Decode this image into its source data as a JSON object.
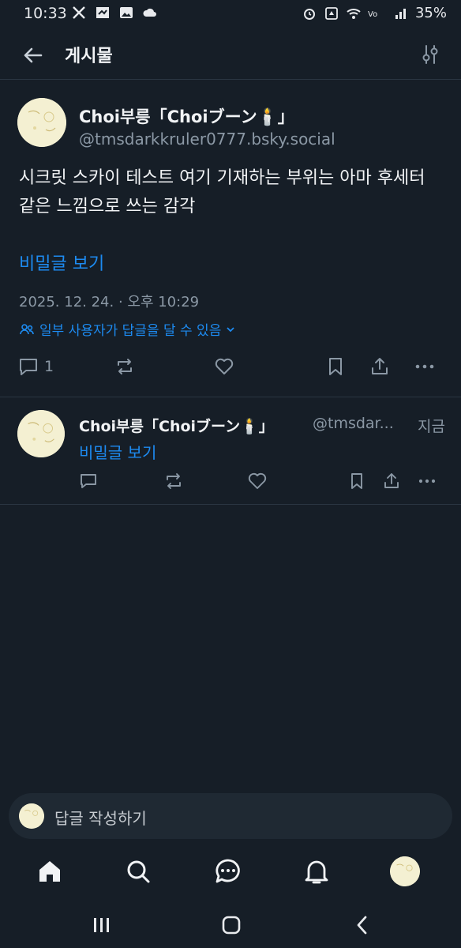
{
  "status_bar": {
    "time": "10:33",
    "battery": "35%",
    "left_icons": [
      "x-icon",
      "bird-icon",
      "image-icon",
      "cloud-icon"
    ],
    "right_icons": [
      "alarm-icon",
      "recycle-icon",
      "wifi-icon",
      "volte-icon",
      "signal-icon"
    ]
  },
  "header": {
    "title": "게시물"
  },
  "post": {
    "author_name": "Choi부릉「Choiブーン🕯️」",
    "author_handle": "@tmsdarkkruler0777.bsky.social",
    "text": "시크릿 스카이 테스트 여기 기재하는 부위는 아마 후세터 같은 느낌으로 쓰는 감각",
    "link_text": "비밀글 보기",
    "date": "2025. 12. 24. · 오후 10:29",
    "reply_permission": "일부 사용자가 답글을 달 수 있음",
    "reply_count": "1"
  },
  "reply": {
    "author_name": "Choi부릉「Choiブーン🕯️」",
    "author_handle": "@tmsdar...",
    "time": "지금",
    "link_text": "비밀글 보기"
  },
  "composer": {
    "placeholder": "답글 작성하기"
  },
  "bottom_nav": {
    "items": [
      "home-icon",
      "search-icon",
      "chat-icon",
      "bell-icon",
      "profile-avatar"
    ]
  },
  "colors": {
    "background": "#161e27",
    "accent": "#1d8bf1",
    "muted": "#8b98a5",
    "text": "#f1f3f5"
  }
}
